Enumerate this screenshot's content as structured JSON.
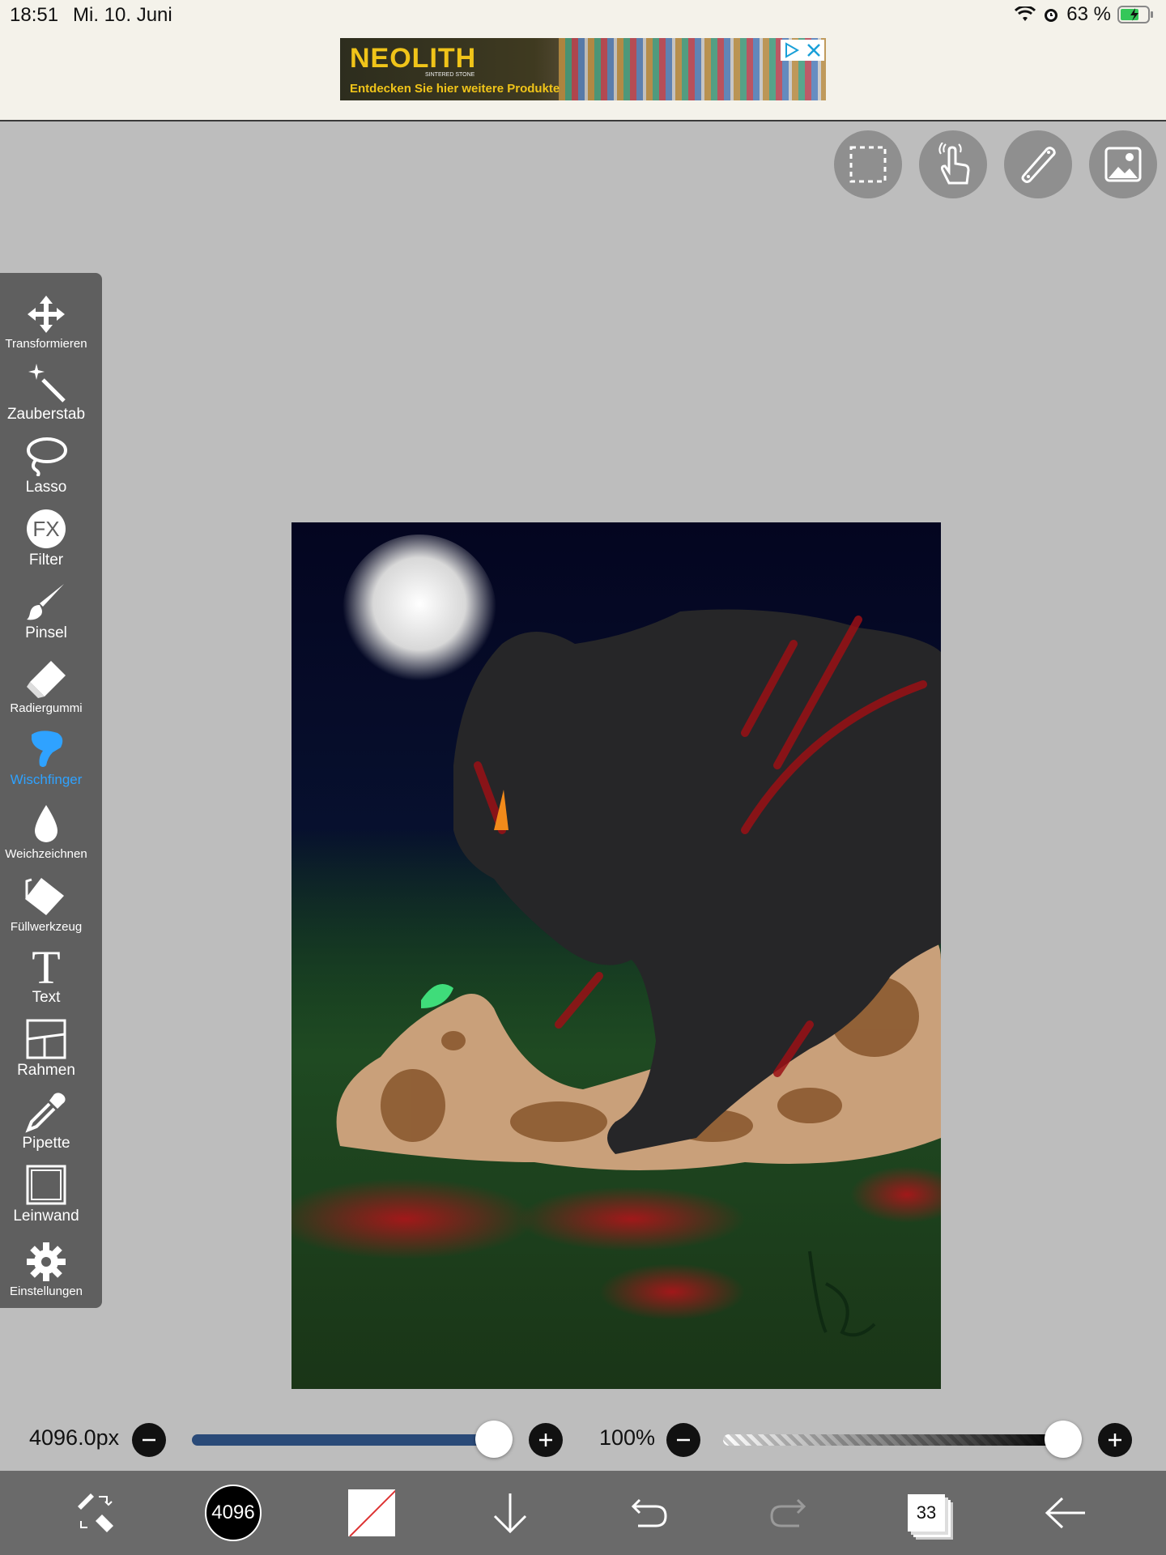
{
  "status": {
    "time": "18:51",
    "date": "Mi. 10. Juni",
    "battery": "63 %"
  },
  "ad": {
    "brand": "NEOLITH",
    "brand_sub": "SINTERED STONE",
    "tagline": "Entdecken Sie hier weitere Produkte"
  },
  "top_buttons": [
    {
      "icon": "selection-icon"
    },
    {
      "icon": "hand-gesture-icon"
    },
    {
      "icon": "ruler-icon"
    },
    {
      "icon": "image-icon"
    }
  ],
  "tools": [
    {
      "label": "Transformieren",
      "icon": "move-icon"
    },
    {
      "label": "Zauberstab",
      "icon": "magic-wand-icon"
    },
    {
      "label": "Lasso",
      "icon": "lasso-icon"
    },
    {
      "label": "Filter",
      "icon": "fx-icon"
    },
    {
      "label": "Pinsel",
      "icon": "brush-icon"
    },
    {
      "label": "Radiergummi",
      "icon": "eraser-icon"
    },
    {
      "label": "Wischfinger",
      "icon": "smudge-icon",
      "active": true
    },
    {
      "label": "Weichzeichnen",
      "icon": "blur-drop-icon"
    },
    {
      "label": "Füllwerkzeug",
      "icon": "fill-bucket-icon"
    },
    {
      "label": "Text",
      "icon": "text-icon"
    },
    {
      "label": "Rahmen",
      "icon": "frame-icon"
    },
    {
      "label": "Pipette",
      "icon": "eyedropper-icon"
    },
    {
      "label": "Leinwand",
      "icon": "canvas-icon"
    },
    {
      "label": "Einstellungen",
      "icon": "gear-icon"
    }
  ],
  "controls": {
    "brush_size": "4096.0px",
    "brush_size_fraction": 1.0,
    "opacity": "100%",
    "opacity_fraction": 1.0
  },
  "bottom": {
    "color_label": "4096",
    "layer_count": "33"
  },
  "colors": {
    "active_tool": "#2fa2ff",
    "toolbar_bg": "#5f5f5f",
    "size_track": "#2a4a78"
  }
}
